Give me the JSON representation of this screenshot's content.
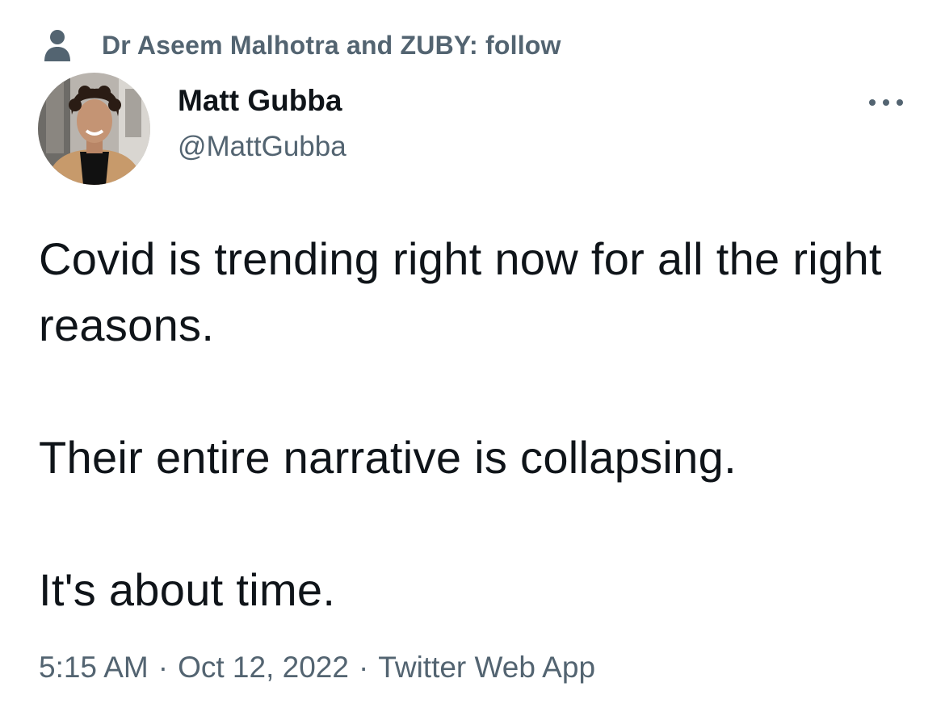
{
  "social_context": {
    "icon": "person-icon",
    "text": "Dr Aseem Malhotra and ZUBY: follow"
  },
  "author": {
    "display_name": "Matt Gubba",
    "handle": "@MattGubba",
    "avatar": "avatar-photo"
  },
  "more_button": {
    "icon": "more-icon"
  },
  "tweet": {
    "paragraphs": [
      "Covid is trending right now for all the right reasons.",
      "Their entire narrative is collapsing.",
      "It's about time."
    ]
  },
  "meta": {
    "time": "5:15 AM",
    "separator": "·",
    "date": "Oct 12, 2022",
    "source": "Twitter Web App"
  },
  "colors": {
    "text_primary": "#0f1419",
    "text_secondary": "#536471",
    "background": "#ffffff"
  }
}
